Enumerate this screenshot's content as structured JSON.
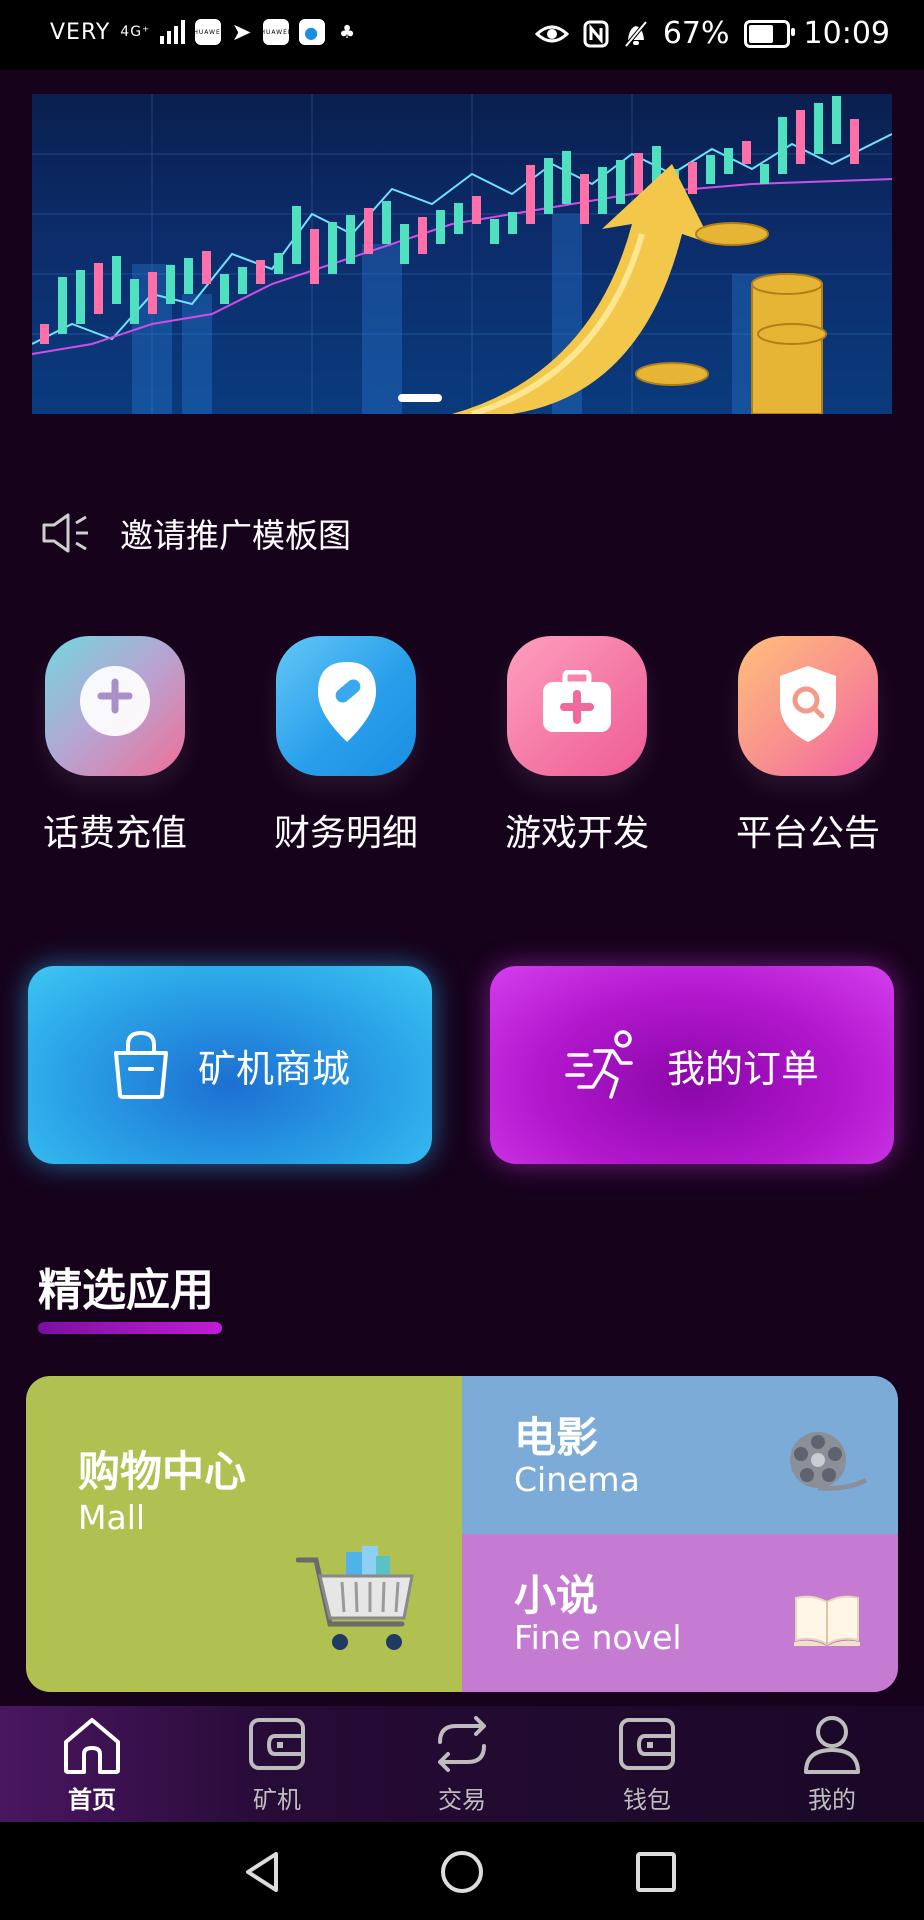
{
  "status_bar": {
    "carrier": "VERY",
    "network": "4G⁺",
    "app_icons": [
      "huawei-icon",
      "telegram-icon",
      "huawei-icon",
      "chat-icon",
      "qq-icon"
    ],
    "app_texts": [
      "HUAWEI",
      "HUAWEI"
    ],
    "battery": "67%",
    "time": "10:09"
  },
  "banner": {
    "page_indicator": "1"
  },
  "notice": {
    "text": "邀请推广模板图"
  },
  "quick_actions": [
    {
      "label": "话费充值",
      "icon": "plus-circle-icon",
      "color_from": "#73d6df",
      "color_to": "#f06f95"
    },
    {
      "label": "财务明细",
      "icon": "location-pill-icon",
      "color_from": "#5fb3f0",
      "color_to": "#1a8ee0"
    },
    {
      "label": "游戏开发",
      "icon": "medkit-icon",
      "color_from": "#ff8ab2",
      "color_to": "#ef5b97"
    },
    {
      "label": "平台公告",
      "icon": "shield-search-icon",
      "color_from": "#ffc07b",
      "color_to": "#f15fa4"
    }
  ],
  "big_buttons": {
    "mall": {
      "label": "矿机商城",
      "icon": "shopping-bag-icon"
    },
    "orders": {
      "label": "我的订单",
      "icon": "running-man-icon"
    }
  },
  "featured": {
    "title": "精选应用",
    "cells": {
      "mall": {
        "title": "购物中心",
        "subtitle": "Mall",
        "icon": "shopping-cart-icon"
      },
      "cinema": {
        "title": "电影",
        "subtitle": "Cinema",
        "icon": "film-reel-icon"
      },
      "novel": {
        "title": "小说",
        "subtitle": "Fine novel",
        "icon": "open-book-icon"
      }
    }
  },
  "bottom_nav": [
    {
      "label": "首页",
      "icon": "home-icon",
      "active": true
    },
    {
      "label": "矿机",
      "icon": "wallet-icon",
      "active": false
    },
    {
      "label": "交易",
      "icon": "exchange-icon",
      "active": false
    },
    {
      "label": "钱包",
      "icon": "wallet-icon",
      "active": false
    },
    {
      "label": "我的",
      "icon": "user-icon",
      "active": false
    }
  ],
  "colors": {
    "background": "#16021b",
    "mall_button": "#2aa4e8",
    "orders_button": "#b318cf",
    "accent_bar": "#c21cd6"
  }
}
